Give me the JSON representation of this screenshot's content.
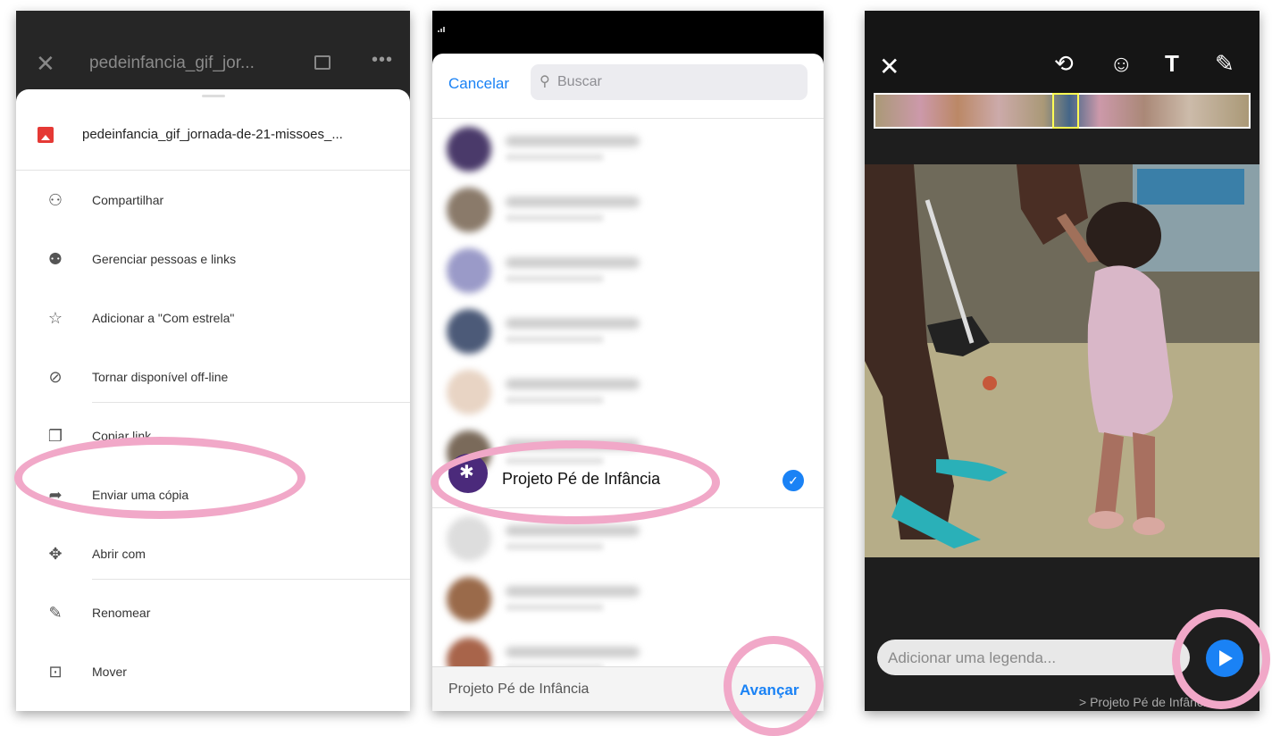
{
  "panel1": {
    "title": "pedeinfancia_gif_jor...",
    "file_name": "pedeinfancia_gif_jornada-de-21-missoes_...",
    "menu": [
      {
        "label": "Compartilhar",
        "icon": "person-add-icon"
      },
      {
        "label": "Gerenciar pessoas e links",
        "icon": "people-icon"
      },
      {
        "label": "Adicionar a \"Com estrela\"",
        "icon": "star-icon"
      },
      {
        "label": "Tornar disponível off-line",
        "icon": "offline-icon"
      },
      {
        "label": "Copiar link",
        "icon": "copy-icon"
      },
      {
        "label": "Enviar uma cópia",
        "icon": "forward-icon"
      },
      {
        "label": "Abrir com",
        "icon": "open-with-icon"
      },
      {
        "label": "Renomear",
        "icon": "pencil-icon"
      },
      {
        "label": "Mover",
        "icon": "move-folder-icon"
      }
    ]
  },
  "panel2": {
    "cancel": "Cancelar",
    "search_placeholder": "Buscar",
    "selected_contact": "Projeto Pé de Infância",
    "footer_selected": "Projeto Pé de Infância",
    "advance": "Avançar"
  },
  "panel3": {
    "caption_placeholder": "Adicionar uma legenda...",
    "recipient": "> Projeto Pé de Infânci"
  },
  "colors": {
    "accent": "#1a82f5",
    "highlight": "#f1a8c8",
    "file_icon": "#e53935"
  }
}
